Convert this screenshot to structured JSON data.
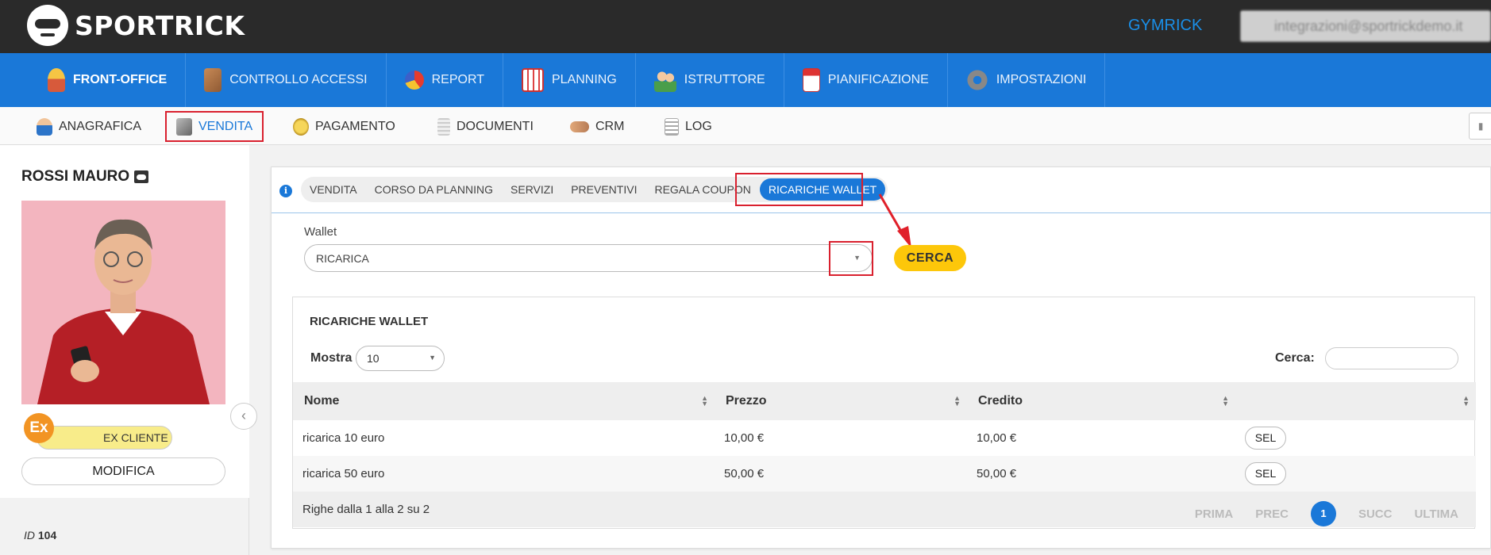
{
  "app": {
    "brand": "SPORTRICK",
    "gym": "GYMRICK",
    "user_email": "integrazioni@sportrickdemo.it"
  },
  "main_nav": [
    {
      "label": "FRONT-OFFICE",
      "icon": "front-office-icon",
      "active": true
    },
    {
      "label": "CONTROLLO ACCESSI",
      "icon": "access-control-icon"
    },
    {
      "label": "REPORT",
      "icon": "report-pie-icon"
    },
    {
      "label": "PLANNING",
      "icon": "planning-calendar-icon"
    },
    {
      "label": "ISTRUTTORE",
      "icon": "instructor-icon"
    },
    {
      "label": "PIANIFICAZIONE",
      "icon": "scheduling-calendar-icon"
    },
    {
      "label": "IMPOSTAZIONI",
      "icon": "settings-gear-icon"
    }
  ],
  "sub_nav": [
    {
      "label": "ANAGRAFICA",
      "icon": "person-icon"
    },
    {
      "label": "VENDITA",
      "icon": "cash-register-icon",
      "active": true
    },
    {
      "label": "PAGAMENTO",
      "icon": "coin-icon"
    },
    {
      "label": "DOCUMENTI",
      "icon": "document-icon"
    },
    {
      "label": "CRM",
      "icon": "handshake-icon"
    },
    {
      "label": "LOG",
      "icon": "log-icon"
    }
  ],
  "customer": {
    "name": "ROSSI MAURO",
    "status": "EX CLIENTE",
    "status_short": "Ex",
    "modify_label": "MODIFICA",
    "id_label": "ID",
    "id_value": "104"
  },
  "tabs": [
    "VENDITA",
    "CORSO DA PLANNING",
    "SERVIZI",
    "PREVENTIVI",
    "REGALA COUPON",
    "RICARICHE WALLET"
  ],
  "form": {
    "wallet_label": "Wallet",
    "wallet_value": "RICARICA",
    "search_button": "CERCA"
  },
  "table": {
    "title": "RICARICHE WALLET",
    "show_label": "Mostra",
    "show_value": "10",
    "search_label": "Cerca:",
    "columns": [
      "Nome",
      "Prezzo",
      "Credito",
      ""
    ],
    "rows": [
      {
        "name": "ricarica 10 euro",
        "price": "10,00 €",
        "credit": "10,00 €",
        "action": "SEL"
      },
      {
        "name": "ricarica 50 euro",
        "price": "50,00 €",
        "credit": "50,00 €",
        "action": "SEL"
      }
    ],
    "footer_info": "Righe dalla 1 alla 2 su 2",
    "pager": {
      "first": "PRIMA",
      "prev": "PREC",
      "current": "1",
      "next": "SUCC",
      "last": "ULTIMA"
    }
  },
  "colors": {
    "nav_blue": "#1a78d8",
    "accent_yellow": "#fdc70a",
    "highlight_red": "#d9202e"
  }
}
